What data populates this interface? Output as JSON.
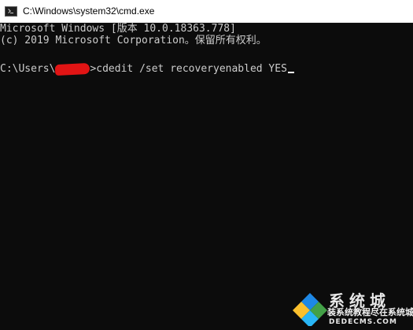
{
  "window": {
    "title": "C:\\Windows\\system32\\cmd.exe",
    "icon": "cmd-icon"
  },
  "console": {
    "banner_line1": "Microsoft Windows [版本 10.0.18363.778]",
    "banner_line2": "(c) 2019 Microsoft Corporation。保留所有权利。",
    "prompt_prefix": "C:\\Users\\",
    "prompt_suffix": ">",
    "command": "cdedit /set recoveryenabled YES",
    "redaction_color": "#e11414",
    "background_color": "#0c0c0c",
    "text_color": "#cccccc"
  },
  "watermark": {
    "title": "系统城",
    "subtitle": "装系统教程尽在系统城",
    "url": "DEDECMS.COM",
    "logo": "windows-logo"
  }
}
